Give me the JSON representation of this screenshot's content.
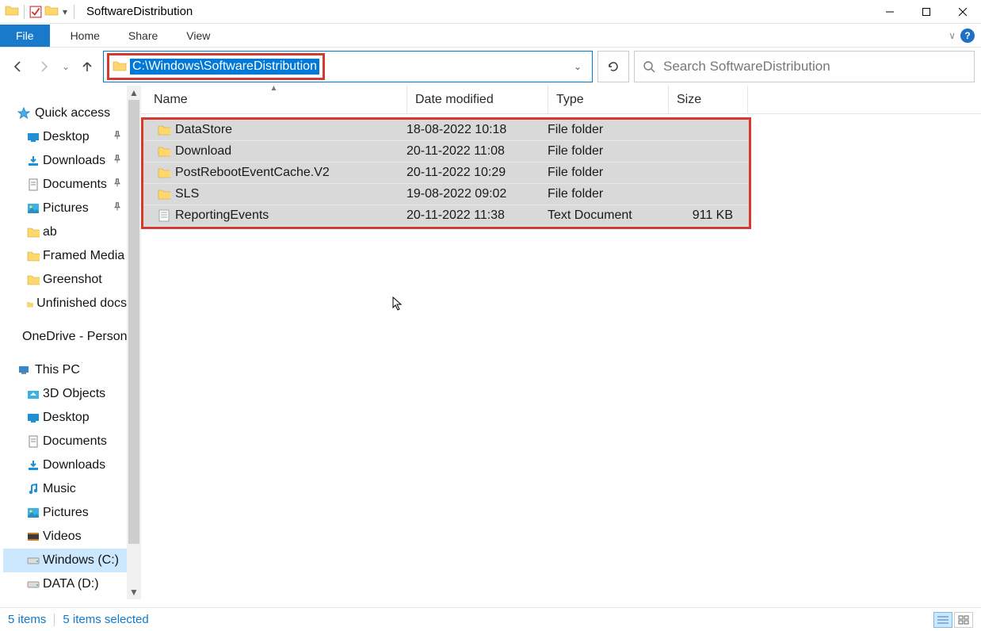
{
  "window": {
    "title": "SoftwareDistribution"
  },
  "ribbon": {
    "file": "File",
    "tabs": [
      "Home",
      "Share",
      "View"
    ]
  },
  "address": {
    "path": "C:\\Windows\\SoftwareDistribution"
  },
  "search": {
    "placeholder": "Search SoftwareDistribution"
  },
  "sidebar": {
    "quick_access": {
      "label": "Quick access"
    },
    "qa_items": [
      {
        "label": "Desktop",
        "pinned": true,
        "icon": "desktop"
      },
      {
        "label": "Downloads",
        "pinned": true,
        "icon": "downloads"
      },
      {
        "label": "Documents",
        "pinned": true,
        "icon": "documents"
      },
      {
        "label": "Pictures",
        "pinned": true,
        "icon": "pictures"
      },
      {
        "label": "ab",
        "pinned": false,
        "icon": "folder"
      },
      {
        "label": "Framed Media",
        "pinned": false,
        "icon": "folder"
      },
      {
        "label": "Greenshot",
        "pinned": false,
        "icon": "folder"
      },
      {
        "label": "Unfinished docs",
        "pinned": false,
        "icon": "folder"
      }
    ],
    "onedrive": {
      "label": "OneDrive - Personal"
    },
    "thispc": {
      "label": "This PC"
    },
    "pc_items": [
      {
        "label": "3D Objects",
        "icon": "3d"
      },
      {
        "label": "Desktop",
        "icon": "desktop"
      },
      {
        "label": "Documents",
        "icon": "documents"
      },
      {
        "label": "Downloads",
        "icon": "downloads"
      },
      {
        "label": "Music",
        "icon": "music"
      },
      {
        "label": "Pictures",
        "icon": "pictures"
      },
      {
        "label": "Videos",
        "icon": "videos"
      },
      {
        "label": "Windows (C:)",
        "icon": "drive",
        "selected": true
      },
      {
        "label": "DATA (D:)",
        "icon": "drive"
      }
    ]
  },
  "columns": {
    "name": "Name",
    "date": "Date modified",
    "type": "Type",
    "size": "Size"
  },
  "files": [
    {
      "name": "DataStore",
      "date": "18-08-2022 10:18",
      "type": "File folder",
      "size": "",
      "icon": "folder"
    },
    {
      "name": "Download",
      "date": "20-11-2022 11:08",
      "type": "File folder",
      "size": "",
      "icon": "folder"
    },
    {
      "name": "PostRebootEventCache.V2",
      "date": "20-11-2022 10:29",
      "type": "File folder",
      "size": "",
      "icon": "folder"
    },
    {
      "name": "SLS",
      "date": "19-08-2022 09:02",
      "type": "File folder",
      "size": "",
      "icon": "folder"
    },
    {
      "name": "ReportingEvents",
      "date": "20-11-2022 11:38",
      "type": "Text Document",
      "size": "911 KB",
      "icon": "text"
    }
  ],
  "status": {
    "items": "5 items",
    "selected": "5 items selected"
  }
}
